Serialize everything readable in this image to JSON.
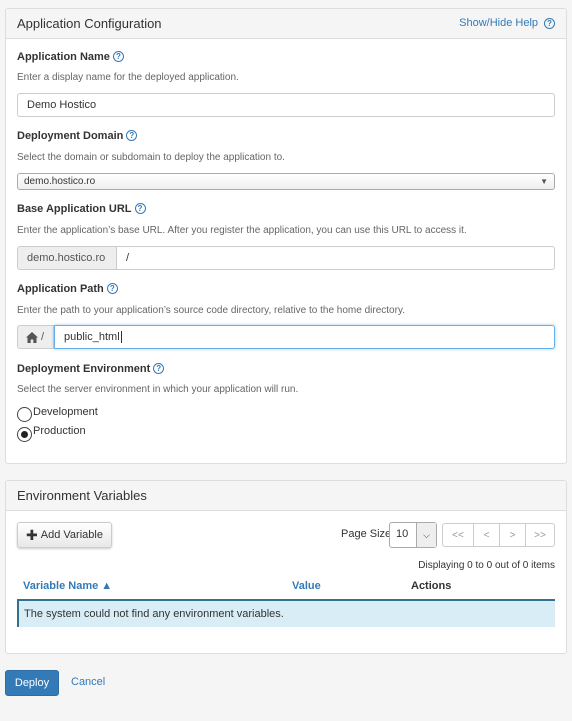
{
  "config": {
    "title": "Application Configuration",
    "help_label": "Show/Hide Help",
    "app_name": {
      "label": "Application Name",
      "hint": "Enter a display name for the deployed application.",
      "value": "Demo Hostico"
    },
    "domain": {
      "label": "Deployment Domain",
      "hint": "Select the domain or subdomain to deploy the application to.",
      "value": "demo.hostico.ro"
    },
    "base_url": {
      "label": "Base Application URL",
      "hint": "Enter the application’s base URL. After you register the application, you can use this URL to access it.",
      "prefix": "demo.hostico.ro",
      "value": "/"
    },
    "path": {
      "label": "Application Path",
      "hint": "Enter the path to your application’s source code directory, relative to the home directory.",
      "prefix_sep": "/",
      "value": "public_html"
    },
    "environment": {
      "label": "Deployment Environment",
      "hint": "Select the server environment in which your application will run.",
      "options": [
        "Development",
        "Production"
      ],
      "selected": "Production"
    }
  },
  "env_vars": {
    "title": "Environment Variables",
    "add_label": "Add Variable",
    "page_size_label": "Page Size",
    "page_size": "10",
    "pager": [
      "<<",
      "<",
      ">",
      ">>"
    ],
    "displaying": "Displaying 0 to 0 out of 0 items",
    "columns": [
      "Variable Name ▲",
      "Value",
      "Actions"
    ],
    "empty_message": "The system could not find any environment variables."
  },
  "actions": {
    "deploy": "Deploy",
    "cancel": "Cancel"
  }
}
